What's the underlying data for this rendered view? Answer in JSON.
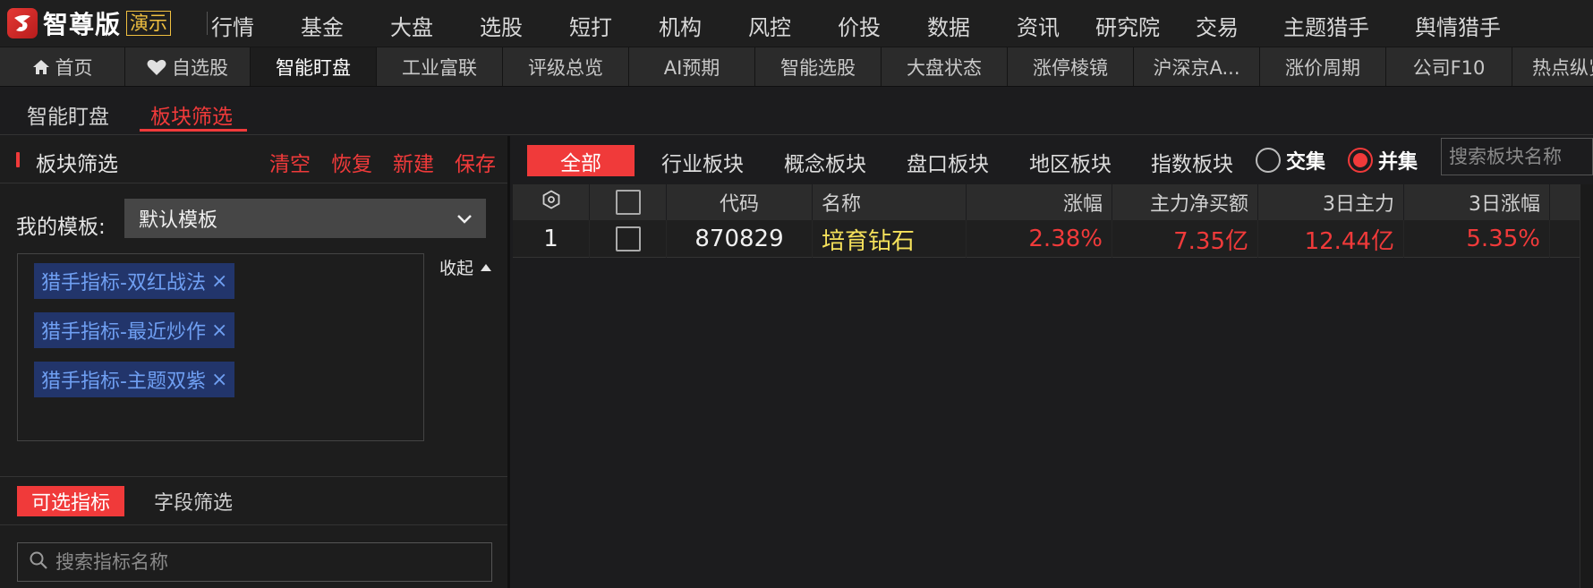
{
  "app": {
    "logo_text": "智尊版",
    "badge": "演示"
  },
  "top_nav": [
    "行情",
    "基金",
    "大盘",
    "选股",
    "短打",
    "机构",
    "风控",
    "价投",
    "数据",
    "资讯",
    "研究院",
    "交易",
    "主题猎手",
    "舆情猎手"
  ],
  "tabs": [
    {
      "label": "首页",
      "icon": "home-icon"
    },
    {
      "label": "自选股",
      "icon": "heart-icon"
    },
    {
      "label": "智能盯盘",
      "active": true
    },
    {
      "label": "工业富联"
    },
    {
      "label": "评级总览"
    },
    {
      "label": "AI预期"
    },
    {
      "label": "智能选股"
    },
    {
      "label": "大盘状态"
    },
    {
      "label": "涨停棱镜"
    },
    {
      "label": "沪深京A..."
    },
    {
      "label": "涨价周期"
    },
    {
      "label": "公司F10"
    },
    {
      "label": "热点纵览"
    }
  ],
  "subtabs": [
    {
      "label": "智能盯盘"
    },
    {
      "label": "板块筛选",
      "active": true
    }
  ],
  "left_panel": {
    "title": "板块筛选",
    "actions": [
      "清空",
      "恢复",
      "新建",
      "保存"
    ],
    "template_label": "我的模板:",
    "template_value": "默认模板",
    "tags": [
      "猎手指标-双红战法",
      "猎手指标-最近炒作",
      "猎手指标-主题双紫"
    ],
    "collapse_label": "收起",
    "bottom_tabs": [
      {
        "label": "可选指标",
        "active": true
      },
      {
        "label": "字段筛选"
      }
    ],
    "search_placeholder": "搜索指标名称"
  },
  "right_panel": {
    "filters": [
      "全部",
      "行业板块",
      "概念板块",
      "盘口板块",
      "地区板块",
      "指数板块"
    ],
    "radios": [
      {
        "label": "交集",
        "checked": false
      },
      {
        "label": "并集",
        "checked": true
      }
    ],
    "search_placeholder": "搜索板块名称",
    "columns": [
      "代码",
      "名称",
      "涨幅",
      "主力净买额",
      "3日主力",
      "3日涨幅"
    ],
    "rows": [
      {
        "index": "1",
        "code": "870829",
        "name": "培育钻石",
        "change": "2.38%",
        "net_buy": "7.35亿",
        "main_3d": "12.44亿",
        "change_3d": "5.35%"
      }
    ]
  },
  "colors": {
    "accent_red": "#f03a3a",
    "tag_blue": "#6f9ff2",
    "name_yellow": "#f5e15b"
  }
}
